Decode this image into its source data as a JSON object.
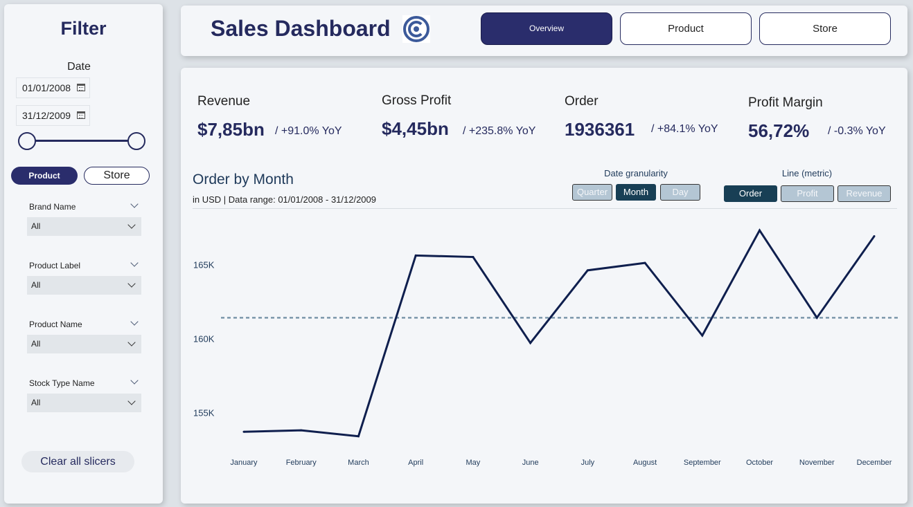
{
  "filter": {
    "title": "Filter",
    "date_label": "Date",
    "start_date": "01/01/2008",
    "end_date": "31/12/2009",
    "toggle": {
      "active": "Product",
      "inactive": "Store"
    },
    "slicers": [
      {
        "label": "Brand Name",
        "value": "All"
      },
      {
        "label": "Product Label",
        "value": "All"
      },
      {
        "label": "Product Name",
        "value": "All"
      },
      {
        "label": "Stock Type Name",
        "value": "All"
      }
    ],
    "clear_label": "Clear all slicers"
  },
  "header": {
    "title": "Sales Dashboard",
    "nav": [
      "Overview",
      "Product",
      "Store"
    ]
  },
  "kpis": [
    {
      "label": "Revenue",
      "value": "$7,85bn",
      "yoy": "/ +91.0%  YoY"
    },
    {
      "label": "Gross Profit",
      "value": "$4,45bn",
      "yoy": "/ +235.8%  YoY"
    },
    {
      "label": "Order",
      "value": "1936361",
      "yoy": "/ +84.1%  YoY"
    },
    {
      "label": "Profit Margin",
      "value": "56,72%",
      "yoy": "/ -0.3%  YoY"
    }
  ],
  "chart_header": {
    "title": "Order by Month",
    "subtitle": "in USD | Data range: 01/01/2008 - 31/12/2009",
    "granularity_title": "Date granularity",
    "granularity": [
      "Quarter",
      "Month",
      "Day"
    ],
    "metric_title": "Line (metric)",
    "metric": [
      "Order",
      "Profit",
      "Revenue"
    ]
  },
  "colors": {
    "line": "#0f1f4e",
    "reference": "#7b97ab",
    "accent": "#2a2d6c"
  },
  "chart_data": {
    "type": "line",
    "title": "Order by Month",
    "x": [
      "January",
      "February",
      "March",
      "April",
      "May",
      "June",
      "July",
      "August",
      "September",
      "October",
      "November",
      "December"
    ],
    "series": [
      {
        "values": [
          153700,
          153800,
          153400,
          165600,
          165500,
          159700,
          164600,
          165100,
          160200,
          167300,
          161400,
          166900
        ]
      }
    ],
    "reference_line": 161400,
    "yticks": [
      155000,
      160000,
      165000
    ],
    "ytick_labels": [
      "155K",
      "160K",
      "165K"
    ],
    "ylim": [
      152500,
      168000
    ],
    "grid": false
  }
}
